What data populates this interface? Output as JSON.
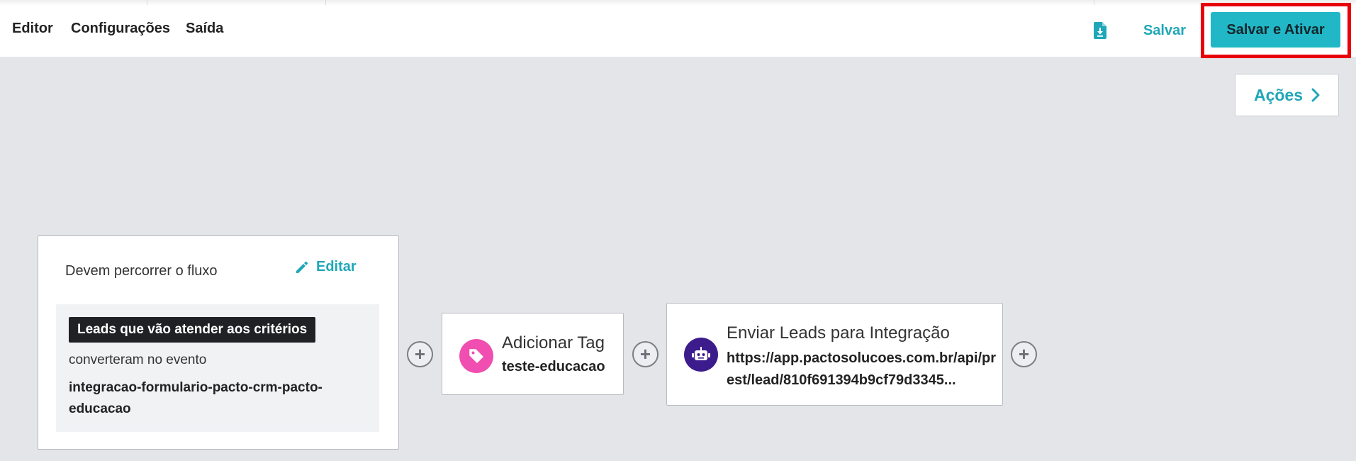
{
  "header": {
    "nav": [
      {
        "label": "Editor"
      },
      {
        "label": "Configurações"
      },
      {
        "label": "Saída"
      }
    ],
    "save_label": "Salvar",
    "save_activate_label": "Salvar e Ativar",
    "highlight_color": "#e8000b",
    "accent_color": "#21b7c7"
  },
  "actions_button": {
    "label": "Ações"
  },
  "flow_card": {
    "title": "Devem percorrer o fluxo",
    "edit_label": "Editar",
    "criteria_badge": "Leads que vão atender aos critérios",
    "criteria_text": "converteram no evento",
    "event_name": "integracao-formulario-pacto-crm-pacto-educacao"
  },
  "tag_card": {
    "title": "Adicionar Tag",
    "value": "teste-educacao",
    "icon": "tag-icon",
    "icon_color": "#f04eb0"
  },
  "integration_card": {
    "title": "Enviar Leads para Integração",
    "url": "https://app.pactosolucoes.com.br/api/prest/lead/810f691394b9cf79d3345...",
    "icon": "robot-icon",
    "icon_color": "#3c1c8c"
  }
}
